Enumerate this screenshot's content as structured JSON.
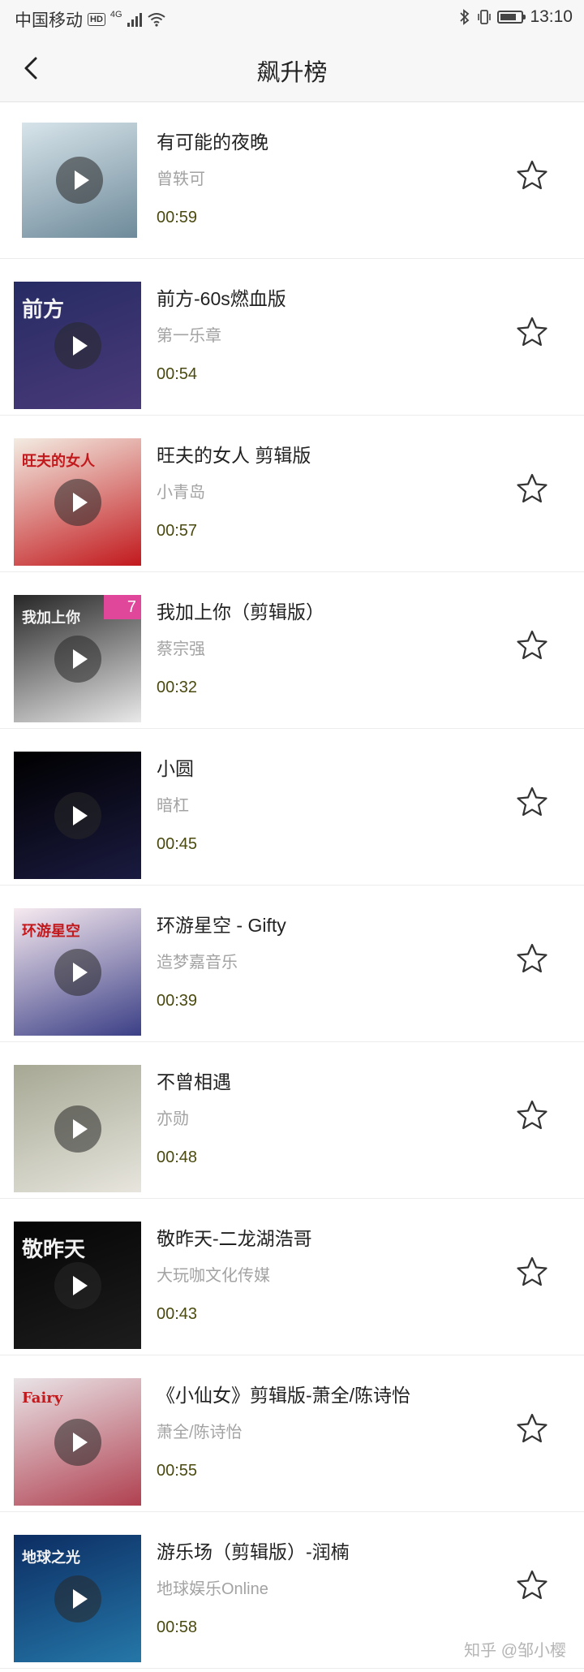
{
  "status_bar": {
    "carrier": "中国移动",
    "hd": "HD",
    "network": "4G",
    "time": "13:10",
    "battery_fraction": 0.8
  },
  "header": {
    "title": "飙升榜",
    "back_icon": "chevron-left-icon"
  },
  "songs": [
    {
      "title": "有可能的夜晚",
      "artist": "曾轶可",
      "duration": "00:59",
      "cover_text": "",
      "colors": [
        "#d7e4ea",
        "#6e8a9a"
      ]
    },
    {
      "title": "前方-60s燃血版",
      "artist": "第一乐章",
      "duration": "00:54",
      "cover_text": "前方",
      "colors": [
        "#262b63",
        "#4a3a7a"
      ]
    },
    {
      "title": "旺夫的女人 剪辑版",
      "artist": "小青岛",
      "duration": "00:57",
      "cover_text": "旺夫的女人",
      "colors": [
        "#f3ece2",
        "#c2191d"
      ]
    },
    {
      "title": "我加上你（剪辑版）",
      "artist": "蔡宗强",
      "duration": "00:32",
      "cover_text": "我加上你",
      "badge": "7",
      "colors": [
        "#262626",
        "#e9e9e9"
      ]
    },
    {
      "title": "小圆",
      "artist": "暗杠",
      "duration": "00:45",
      "cover_text": "",
      "colors": [
        "#000000",
        "#1a1a40"
      ]
    },
    {
      "title": "环游星空 - Gifty",
      "artist": "造梦嘉音乐",
      "duration": "00:39",
      "cover_text": "环游星空",
      "colors": [
        "#f7eaf0",
        "#3b3f86"
      ]
    },
    {
      "title": "不曾相遇",
      "artist": "亦勋",
      "duration": "00:48",
      "cover_text": "",
      "colors": [
        "#a6a894",
        "#e7e5dd"
      ]
    },
    {
      "title": "敬昨天-二龙湖浩哥",
      "artist": "大玩咖文化传媒",
      "duration": "00:43",
      "cover_text": "敬昨天",
      "colors": [
        "#050505",
        "#1d1d1d"
      ]
    },
    {
      "title": "《小仙女》剪辑版-萧全/陈诗怡",
      "artist": "萧全/陈诗怡",
      "duration": "00:55",
      "cover_text": "Fairy",
      "colors": [
        "#e9e4e7",
        "#b04050"
      ]
    },
    {
      "title": "游乐场（剪辑版）-润楠",
      "artist": "地球娱乐Online",
      "duration": "00:58",
      "cover_text": "地球之光",
      "colors": [
        "#0c2d63",
        "#2577a8"
      ]
    }
  ],
  "icons": {
    "play": "play-icon",
    "favorite": "star-outline-icon"
  },
  "watermark": "知乎 @邹小樱"
}
